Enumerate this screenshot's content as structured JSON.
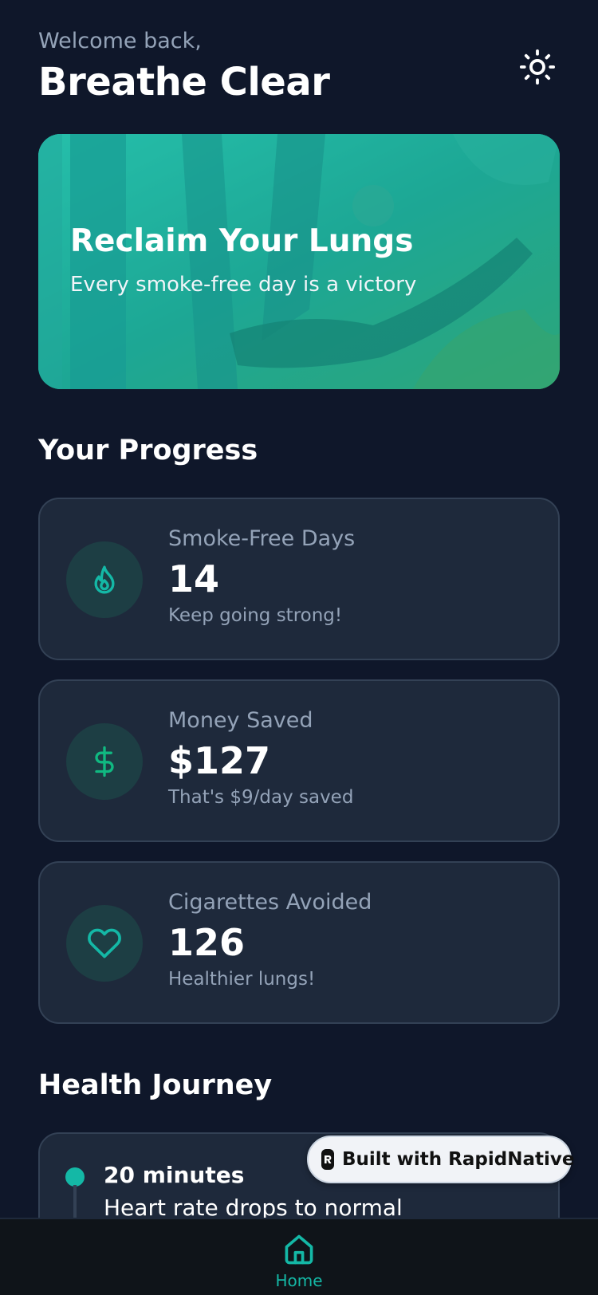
{
  "header": {
    "welcome": "Welcome back,",
    "title": "Breathe Clear",
    "theme_icon": "sun-icon"
  },
  "hero": {
    "title": "Reclaim Your Lungs",
    "subtitle": "Every smoke-free day is a victory"
  },
  "progress": {
    "section_title": "Your Progress",
    "stats": [
      {
        "icon": "flame-icon",
        "label": "Smoke-Free Days",
        "value": "14",
        "note": "Keep going strong!"
      },
      {
        "icon": "dollar-icon",
        "label": "Money Saved",
        "value": "$127",
        "note": "That's $9/day saved"
      },
      {
        "icon": "heart-icon",
        "label": "Cigarettes Avoided",
        "value": "126",
        "note": "Healthier lungs!"
      }
    ]
  },
  "journey": {
    "section_title": "Health Journey",
    "milestones": [
      {
        "time": "20 minutes",
        "description": "Heart rate drops to normal"
      }
    ]
  },
  "badge": {
    "label": "Built with RapidNative"
  },
  "nav": {
    "items": [
      {
        "label": "Home",
        "icon": "home-icon",
        "active": true
      }
    ]
  },
  "colors": {
    "background": "#0f172a",
    "card": "#1e293b",
    "accent": "#14b8a6",
    "muted_text": "#94a3b8"
  }
}
